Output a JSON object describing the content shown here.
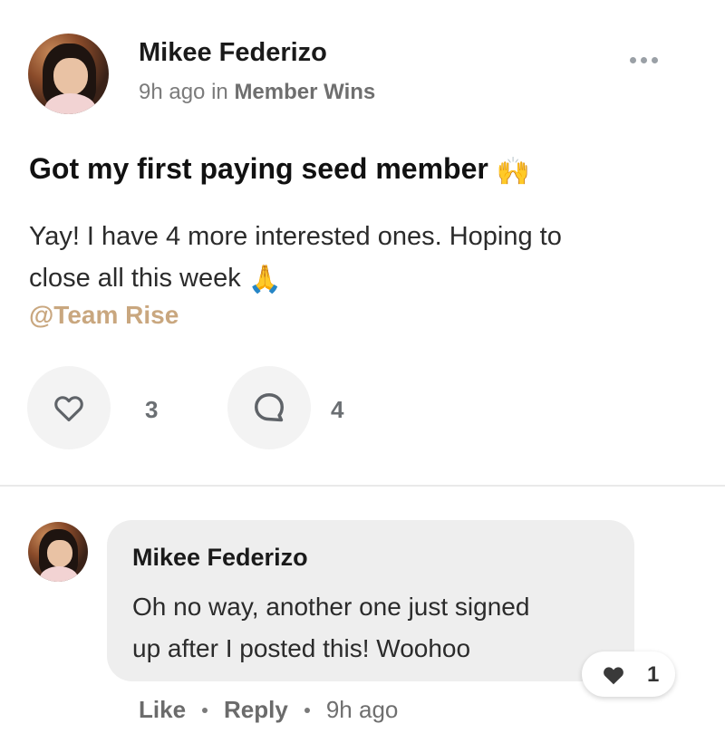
{
  "post": {
    "author": "Mikee Federizo",
    "time": "9h ago",
    "in_label": "in",
    "community": "Member Wins",
    "title": "Got my first paying seed member",
    "title_emoji": "🙌",
    "body_line1": "Yay! I have 4 more interested ones. Hoping to",
    "body_line2": "close all this week",
    "body_emoji": "🙏",
    "mention": "@Team Rise",
    "like_count": "3",
    "comment_count": "4"
  },
  "comment": {
    "author": "Mikee Federizo",
    "text_line1": "Oh no way, another one just signed",
    "text_line2": "up after I posted this! Woohoo",
    "reaction_count": "1",
    "like_label": "Like",
    "reply_label": "Reply",
    "time": "9h ago"
  },
  "icons": {
    "more": "more-horizontal-icon",
    "like": "heart-outline-icon",
    "comment": "comment-bubble-icon",
    "reaction": "heart-filled-icon"
  }
}
